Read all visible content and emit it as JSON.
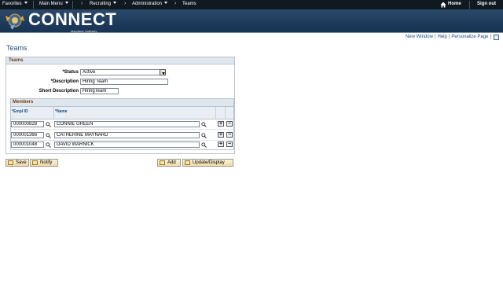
{
  "topnav": {
    "favorites": "Favorites",
    "main_menu": "Main Menu",
    "breadcrumb": [
      "Recruiting",
      "Administration",
      "Teams"
    ],
    "home": "Home",
    "sign_out": "Sign out"
  },
  "banner": {
    "logo_text": "CONNECT",
    "logo_sub": "Maryland Judiciary"
  },
  "page_links": {
    "new_window": "New Window",
    "help": "Help",
    "personalize": "Personalize Page"
  },
  "page_title": "Teams",
  "teams": {
    "header": "Teams",
    "status_label": "*Status",
    "status_value": "Active",
    "description_label": "*Description",
    "description_value": "Hiring Team",
    "short_description_label": "Short Description",
    "short_description_value": "HiringTeam"
  },
  "members": {
    "header": "Members",
    "col_emplid": "*Empl ID",
    "col_name": "*Name",
    "rows": [
      {
        "emplid": "000000828",
        "name": "CONNIE GREEN"
      },
      {
        "emplid": "000001366",
        "name": "CATHERINE MAYNARD"
      },
      {
        "emplid": "000001048",
        "name": "DAVID WARNICK"
      }
    ],
    "add_row": "+",
    "delete_row": "−"
  },
  "buttons": {
    "save": "Save",
    "notify": "Notify",
    "add": "Add",
    "update_display": "Update/Display"
  },
  "colors": {
    "nav_bg": "#101820",
    "banner_bg": "#1d3a5a",
    "title": "#1f4e7a",
    "group_header": "#7a3f12",
    "link": "#1a4a8a"
  }
}
